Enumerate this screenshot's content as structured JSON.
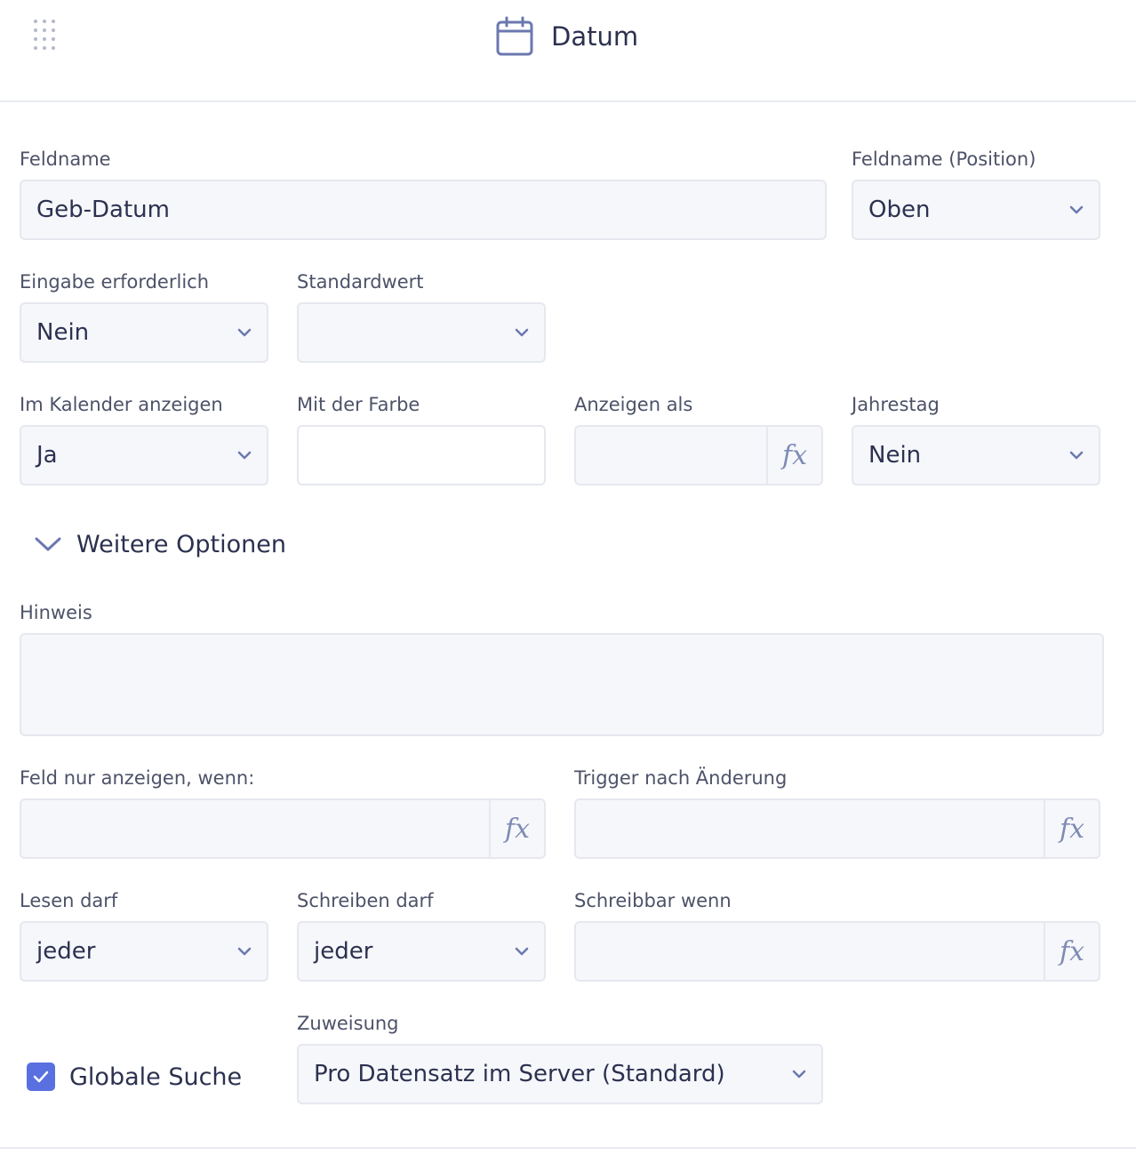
{
  "header": {
    "title": "Datum",
    "icon": "calendar-icon"
  },
  "fields": {
    "feldname": {
      "label": "Feldname",
      "value": "Geb-Datum"
    },
    "feldname_position": {
      "label": "Feldname (Position)",
      "value": "Oben"
    },
    "eingabe": {
      "label": "Eingabe erforderlich",
      "value": "Nein"
    },
    "standardwert": {
      "label": "Standardwert",
      "value": ""
    },
    "kalender": {
      "label": "Im Kalender anzeigen",
      "value": "Ja"
    },
    "farbe": {
      "label": "Mit der Farbe",
      "value": ""
    },
    "anzeigen_als": {
      "label": "Anzeigen als",
      "value": "",
      "fx": "fx"
    },
    "jahrestag": {
      "label": "Jahrestag",
      "value": "Nein"
    },
    "hinweis": {
      "label": "Hinweis",
      "value": ""
    },
    "feld_anzeigen": {
      "label": "Feld nur anzeigen, wenn:",
      "value": "",
      "fx": "fx"
    },
    "trigger": {
      "label": "Trigger nach Änderung",
      "value": "",
      "fx": "fx"
    },
    "lesen": {
      "label": "Lesen darf",
      "value": "jeder"
    },
    "schreiben": {
      "label": "Schreiben darf",
      "value": "jeder"
    },
    "schreibbar": {
      "label": "Schreibbar wenn",
      "value": "",
      "fx": "fx"
    },
    "zuweisung": {
      "label": "Zuweisung",
      "value": "Pro Datensatz im Server (Standard)"
    }
  },
  "more_options": {
    "label": "Weitere Optionen"
  },
  "globale_suche": {
    "label": "Globale Suche",
    "checked": true
  },
  "colors": {
    "accent": "#5a6fe0",
    "icon": "#6b78b0",
    "border": "#e6e8ef",
    "field_bg": "#f6f7fb"
  }
}
